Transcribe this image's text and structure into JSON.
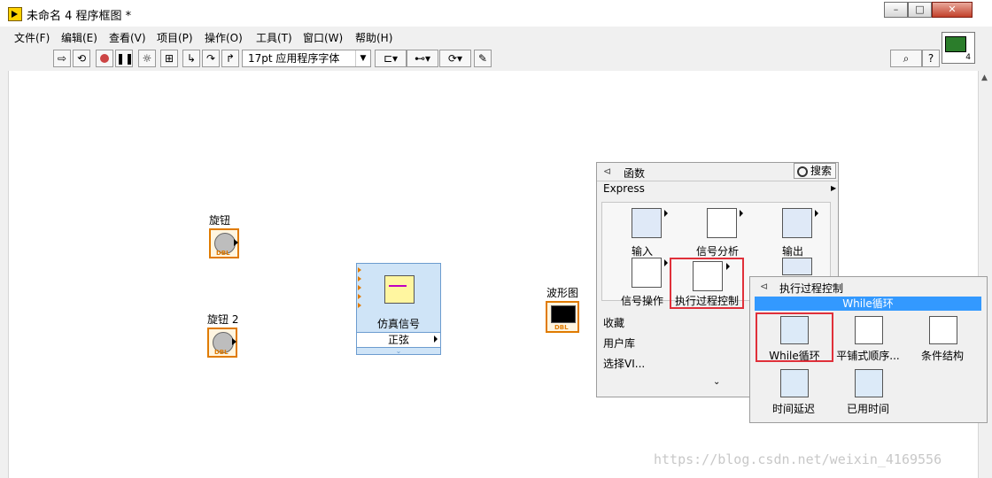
{
  "window": {
    "title": "未命名 4 程序框图 *",
    "controls": {
      "minimize": "–",
      "maximize": "□",
      "close": "✕"
    }
  },
  "menubar": {
    "items": [
      "文件(F)",
      "编辑(E)",
      "查看(V)",
      "项目(P)",
      "操作(O)",
      "工具(T)",
      "窗口(W)",
      "帮助(H)"
    ]
  },
  "toolbar": {
    "font_selector": "17pt 应用程序字体",
    "connector_number": "4"
  },
  "diagram": {
    "knob1_label": "旋钮",
    "knob2_label": "旋钮 2",
    "knob_type": "DBL",
    "express_vi_title": "仿真信号",
    "express_vi_mode": "正弦",
    "waveform_label": "波形图",
    "waveform_type": "DBL"
  },
  "functions_palette": {
    "title": "函数",
    "search_label": "搜索",
    "express_label": "Express",
    "express_items": [
      "输入",
      "信号分析",
      "输出",
      "信号操作",
      "执行过程控制"
    ],
    "categories": [
      "收藏",
      "用户库",
      "选择VI..."
    ]
  },
  "sub_palette": {
    "title": "执行过程控制",
    "selected_name": "While循环",
    "items": [
      "While循环",
      "平铺式顺序...",
      "条件结构",
      "时间延迟",
      "已用时间"
    ]
  },
  "watermark": "https://blog.csdn.net/weixin_4169556",
  "colors": {
    "terminal_orange": "#e07b00",
    "express_blue": "#cfe4f7",
    "selection_blue": "#3399ff",
    "highlight_red": "#e0303a"
  }
}
